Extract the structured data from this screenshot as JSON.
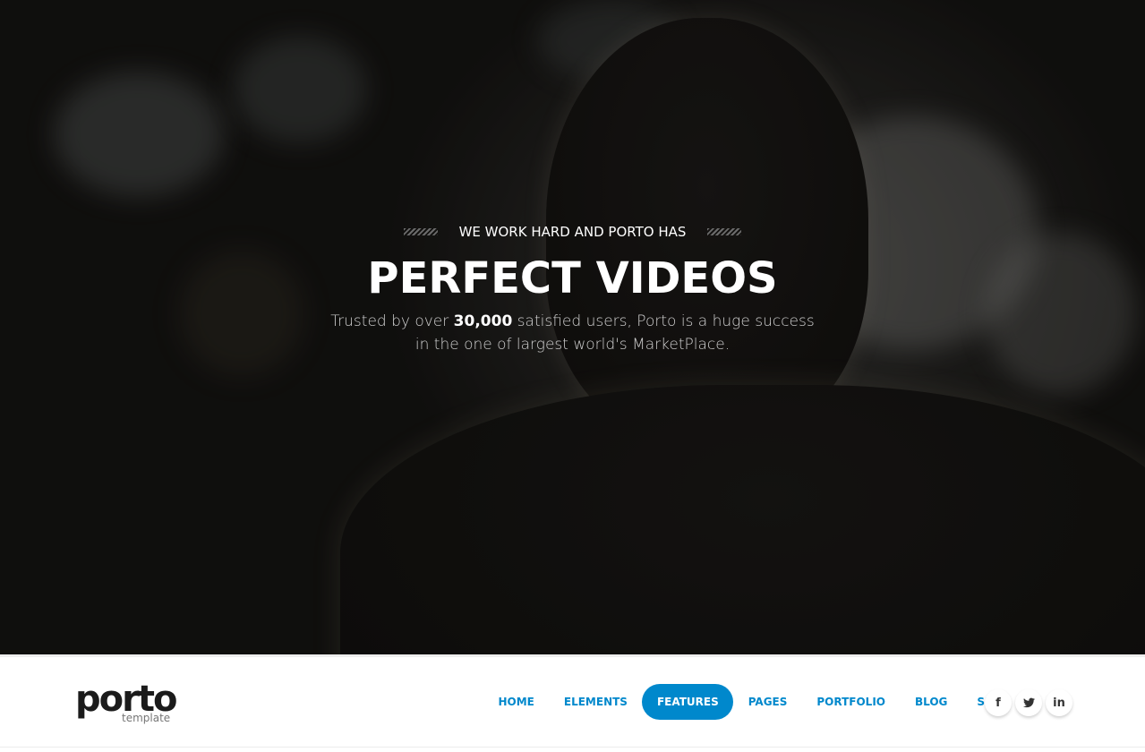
{
  "hero": {
    "kicker": "WE WORK HARD AND PORTO HAS",
    "title": "PERFECT VIDEOS",
    "description_before": "Trusted by over ",
    "description_highlight": "30,000",
    "description_after": " satisfied users, Porto is a huge success in the one of largest world's MarketPlace."
  },
  "logo": {
    "word": "porto",
    "sub": "template"
  },
  "nav": {
    "items": [
      {
        "label": "HOME",
        "active": false
      },
      {
        "label": "ELEMENTS",
        "active": false
      },
      {
        "label": "FEATURES",
        "active": true
      },
      {
        "label": "PAGES",
        "active": false
      },
      {
        "label": "PORTFOLIO",
        "active": false
      },
      {
        "label": "BLOG",
        "active": false
      },
      {
        "label": "SHOP",
        "active": false
      }
    ]
  },
  "social": [
    {
      "icon": "facebook-icon",
      "glyph": "f"
    },
    {
      "icon": "twitter-icon",
      "glyph": "🐦"
    },
    {
      "icon": "linkedin-icon",
      "glyph": "in"
    }
  ],
  "colors": {
    "accent": "#0088cc",
    "hero_dark": "#1a1816"
  }
}
